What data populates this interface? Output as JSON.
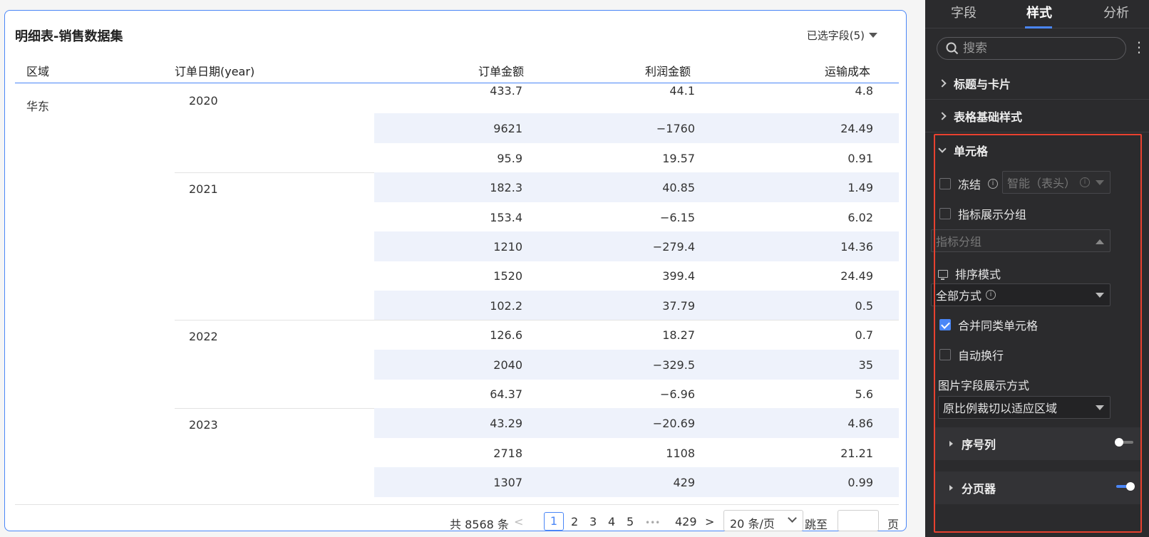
{
  "table": {
    "title": "明细表-销售数据集",
    "fields_selected": "已选字段(5)",
    "columns": [
      "区域",
      "订单日期(year)",
      "订单金额",
      "利润金额",
      "运输成本"
    ],
    "region": "华东",
    "groups": [
      {
        "year": "2020",
        "rows": [
          [
            "433.7",
            "44.1",
            "4.8"
          ],
          [
            "9621",
            "−1760",
            "24.49"
          ],
          [
            "95.9",
            "19.57",
            "0.91"
          ]
        ]
      },
      {
        "year": "2021",
        "rows": [
          [
            "182.3",
            "40.85",
            "1.49"
          ],
          [
            "153.4",
            "−6.15",
            "6.02"
          ],
          [
            "1210",
            "−279.4",
            "14.36"
          ],
          [
            "1520",
            "399.4",
            "24.49"
          ],
          [
            "102.2",
            "37.79",
            "0.5"
          ]
        ]
      },
      {
        "year": "2022",
        "rows": [
          [
            "126.6",
            "18.27",
            "0.7"
          ],
          [
            "2040",
            "−329.5",
            "35"
          ],
          [
            "64.37",
            "−6.96",
            "5.6"
          ]
        ]
      },
      {
        "year": "2023",
        "rows": [
          [
            "43.29",
            "−20.69",
            "4.86"
          ],
          [
            "2718",
            "1108",
            "21.21"
          ],
          [
            "1307",
            "429",
            "0.99"
          ]
        ]
      }
    ]
  },
  "pager": {
    "total": "共 8568 条",
    "prev": "<",
    "pages": [
      "1",
      "2",
      "3",
      "4",
      "5"
    ],
    "ellipsis": "•••",
    "last": "429",
    "next": ">",
    "page_size": "20 条/页",
    "jump_label": "跳至",
    "page_suffix": "页"
  },
  "panel": {
    "tabs": [
      "字段",
      "样式",
      "分析"
    ],
    "active_tab": "样式",
    "search_placeholder": "搜索",
    "sections": {
      "title_card": "标题与卡片",
      "table_basic": "表格基础样式",
      "cell": "单元格"
    },
    "cell": {
      "freeze": {
        "label": "冻结",
        "checked": false,
        "select": "智能（表头）"
      },
      "metric_group": {
        "label": "指标展示分组",
        "checked": false,
        "select_placeholder": "指标分组"
      },
      "sort_mode": {
        "label": "排序模式",
        "select": "全部方式"
      },
      "merge_cells": {
        "label": "合并同类单元格",
        "checked": true
      },
      "auto_wrap": {
        "label": "自动换行",
        "checked": false
      },
      "image_display": {
        "label": "图片字段展示方式",
        "select": "原比例裁切以适应区域"
      },
      "serial_column": {
        "label": "序号列",
        "on": false
      },
      "paginator": {
        "label": "分页器",
        "on": true
      }
    }
  },
  "colors": {
    "accent": "#4a86f7",
    "highlight_border": "#e8412f",
    "row_alt": "#eef2fb",
    "panel_bg": "#2b2b2d"
  }
}
